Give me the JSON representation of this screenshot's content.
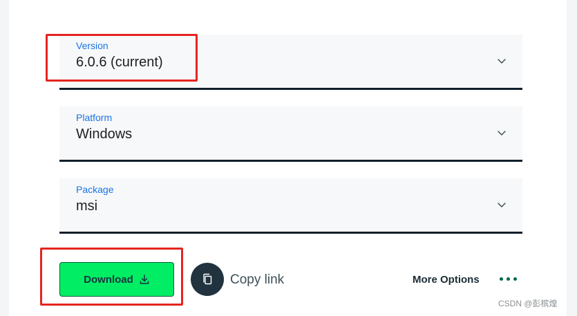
{
  "version_select": {
    "label": "Version",
    "value": "6.0.6 (current)",
    "icon": "chevron-down-icon"
  },
  "platform_select": {
    "label": "Platform",
    "value": "Windows",
    "icon": "chevron-down-icon"
  },
  "package_select": {
    "label": "Package",
    "value": "msi",
    "icon": "chevron-down-icon"
  },
  "actions": {
    "download_label": "Download",
    "download_icon": "download-icon",
    "copy_icon": "copy-icon",
    "copy_label": "Copy link",
    "more_options_label": "More Options",
    "more_icon": "more-dots-icon"
  },
  "watermark": "CSDN @彭槟煌",
  "colors": {
    "label_blue": "#1a73e8",
    "underline": "#0f1e2b",
    "download_green": "#00ed64",
    "copy_circle": "#20333f",
    "dots_green": "#00684a",
    "highlight_red": "#e52420"
  }
}
